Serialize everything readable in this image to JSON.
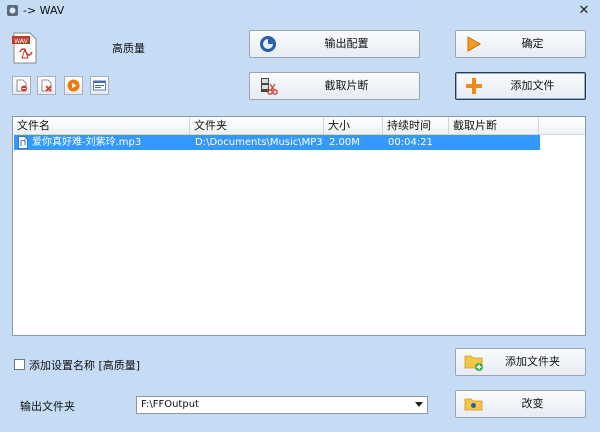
{
  "window": {
    "title": "-> WAV",
    "close_glyph": "✕"
  },
  "preset": {
    "label": "高质量",
    "icon": "wav-file-icon"
  },
  "buttons": {
    "output_config": "输出配置",
    "ok": "确定",
    "clip": "截取片断",
    "add_file": "添加文件",
    "add_folder": "添加文件夹",
    "change": "改变"
  },
  "small_toolbar": [
    "remove-file-icon",
    "clear-list-icon",
    "play-icon",
    "media-info-icon"
  ],
  "table": {
    "columns": [
      "文件名",
      "文件夹",
      "大小",
      "持续时间",
      "截取片断"
    ],
    "rows": [
      {
        "name": "爱你真好难-刘紫玲.mp3",
        "folder": "D:\\Documents\\Music\\MP3",
        "size": "2.00M",
        "duration": "00:04:21",
        "clip": ""
      }
    ]
  },
  "add_setting_name": {
    "label": "添加设置名称 [高质量]",
    "checked": false
  },
  "output_folder": {
    "label": "输出文件夹",
    "value": "F:\\FFOutput"
  },
  "colors": {
    "background": "#c6dcf5",
    "selection": "#3399ff"
  }
}
